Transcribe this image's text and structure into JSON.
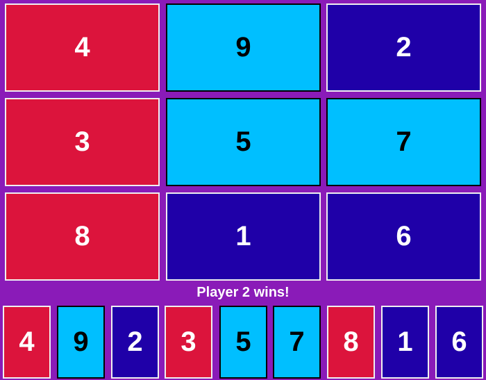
{
  "colors": {
    "background": "#8a1bb8",
    "p1": "#dc143c",
    "p2": "#1f00a8",
    "open": "#00bfff",
    "text_light": "#ffffff",
    "text_dark": "#000000"
  },
  "status_text": "Player 2 wins!",
  "board": [
    {
      "value": "4",
      "owner": "p1"
    },
    {
      "value": "9",
      "owner": "open"
    },
    {
      "value": "2",
      "owner": "p2"
    },
    {
      "value": "3",
      "owner": "p1"
    },
    {
      "value": "5",
      "owner": "open"
    },
    {
      "value": "7",
      "owner": "open"
    },
    {
      "value": "8",
      "owner": "p1"
    },
    {
      "value": "1",
      "owner": "p2"
    },
    {
      "value": "6",
      "owner": "p2"
    }
  ],
  "hand": [
    {
      "value": "4",
      "owner": "p1"
    },
    {
      "value": "9",
      "owner": "open"
    },
    {
      "value": "2",
      "owner": "p2"
    },
    {
      "value": "3",
      "owner": "p1"
    },
    {
      "value": "5",
      "owner": "open"
    },
    {
      "value": "7",
      "owner": "open"
    },
    {
      "value": "8",
      "owner": "p1"
    },
    {
      "value": "1",
      "owner": "p2"
    },
    {
      "value": "6",
      "owner": "p2"
    }
  ]
}
